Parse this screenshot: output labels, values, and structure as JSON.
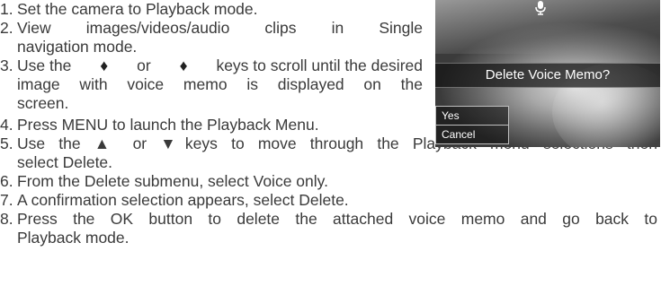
{
  "steps": [
    {
      "num": "1.",
      "lines": [
        "Set the camera to Playback mode."
      ]
    },
    {
      "num": "2.",
      "lines": [
        "View images/videos/audio clips in Single",
        "navigation mode."
      ]
    },
    {
      "num": "3.",
      "lines_parts": [
        [
          "Use the ",
          "♒",
          " or ",
          "⨒",
          " keys to scroll until the desired"
        ],
        [
          "image with voice memo is displayed on the"
        ],
        [
          "screen."
        ]
      ]
    },
    {
      "num": "4.",
      "lines": [
        "Press MENU to launch the Playback Menu."
      ]
    },
    {
      "num": "5.",
      "lines": [
        "Use the ▲ or ▼keys to move through the Playback menu selections then",
        "select Delete."
      ]
    },
    {
      "num": "6.",
      "lines": [
        "From the Delete submenu, select Voice only."
      ]
    },
    {
      "num": "7.",
      "lines": [
        "A confirmation selection appears, select Delete."
      ]
    },
    {
      "num": "8.",
      "lines": [
        "Press the OK button to delete the attached voice memo and go back to",
        "Playback mode."
      ]
    }
  ],
  "screen": {
    "mic_icon": "microphone-icon",
    "banner": "Delete Voice Memo?",
    "options": [
      "Yes",
      "Cancel"
    ]
  }
}
